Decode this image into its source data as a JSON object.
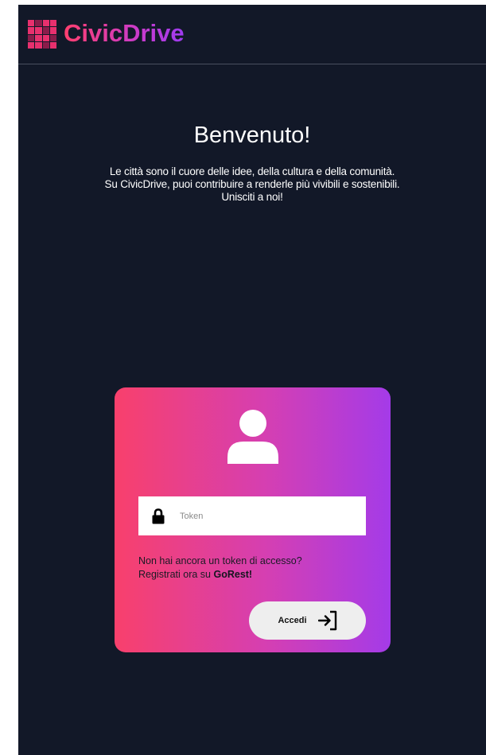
{
  "header": {
    "brand": "CivicDrive",
    "logo_icon": "puzzle-logo-icon"
  },
  "hero": {
    "title": "Benvenuto!",
    "lines": [
      "Le città sono il cuore delle idee, della cultura e della comunità.",
      "Su CivicDrive, puoi contribuire a renderle più vivibili e sostenibili.",
      "Unisciti a noi!"
    ]
  },
  "login": {
    "avatar_icon": "user-icon",
    "field_icon": "lock-icon",
    "token_placeholder": "Token",
    "token_value": "",
    "hint_line1": "Non hai ancora un token di accesso?",
    "hint_line2_prefix": "Registrati ora su ",
    "hint_link": "GoRest!",
    "submit_label": "Accedi",
    "submit_icon": "login-arrow-icon"
  },
  "colors": {
    "background": "#121828",
    "gradient_start": "#f8406c",
    "gradient_end": "#a43be8",
    "button": "#eeeeee"
  }
}
